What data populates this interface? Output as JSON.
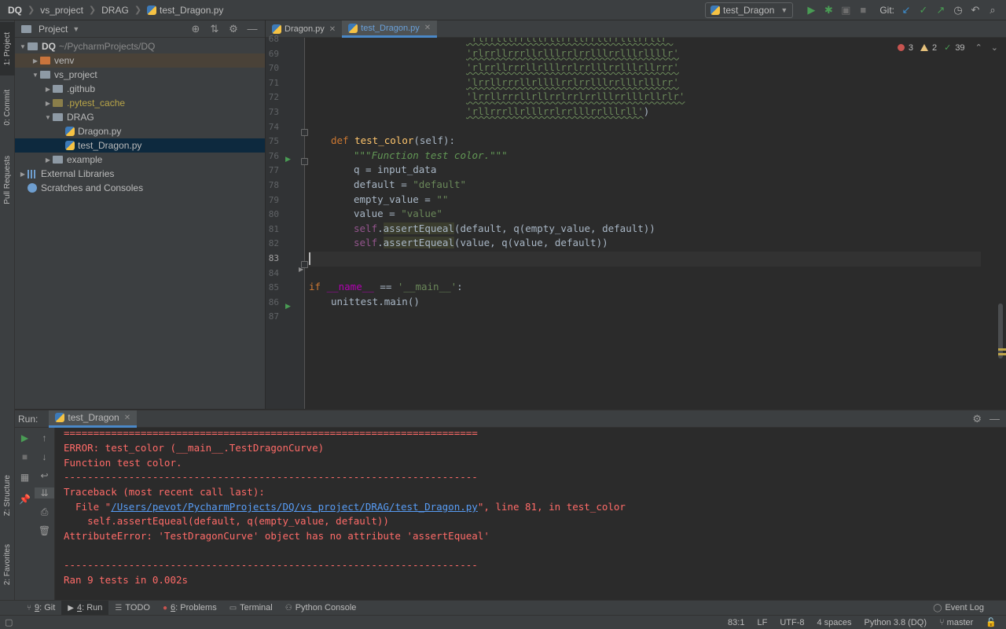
{
  "breadcrumbs": [
    "DQ",
    "vs_project",
    "DRAG",
    "test_Dragon.py"
  ],
  "toolbar": {
    "run_config": "test_Dragon",
    "git_label": "Git:"
  },
  "left_stripe": {
    "project": "1: Project",
    "commit": "0: Commit",
    "pull_requests": "Pull Requests",
    "structure": "Z: Structure",
    "favorites": "2: Favorites"
  },
  "project_panel": {
    "title": "Project",
    "tree": [
      {
        "label": "DQ",
        "hint": "~/PycharmProjects/DQ",
        "indent": 0,
        "expanded": true,
        "kind": "root"
      },
      {
        "label": "venv",
        "indent": 1,
        "expanded": false,
        "kind": "folder-orange"
      },
      {
        "label": "vs_project",
        "indent": 1,
        "expanded": true,
        "kind": "folder"
      },
      {
        "label": ".github",
        "indent": 2,
        "expanded": false,
        "kind": "folder"
      },
      {
        "label": ".pytest_cache",
        "indent": 2,
        "expanded": false,
        "kind": "folder-yellow"
      },
      {
        "label": "DRAG",
        "indent": 2,
        "expanded": true,
        "kind": "folder"
      },
      {
        "label": "Dragon.py",
        "indent": 3,
        "kind": "python"
      },
      {
        "label": "test_Dragon.py",
        "indent": 3,
        "kind": "python",
        "selected": true
      },
      {
        "label": "example",
        "indent": 2,
        "expanded": false,
        "kind": "folder"
      },
      {
        "label": "External Libraries",
        "indent": 0,
        "expanded": false,
        "kind": "library"
      },
      {
        "label": "Scratches and Consoles",
        "indent": 0,
        "kind": "scratch"
      }
    ]
  },
  "editor": {
    "tabs": [
      {
        "label": "Dragon.py",
        "active": false
      },
      {
        "label": "test_Dragon.py",
        "active": true
      }
    ],
    "inspections": {
      "errors": "3",
      "warnings": "2",
      "ok": "39"
    },
    "line_numbers": [
      "68",
      "69",
      "70",
      "71",
      "72",
      "73",
      "74",
      "75",
      "76",
      "77",
      "78",
      "79",
      "80",
      "81",
      "82",
      "83",
      "84",
      "85",
      "86",
      "87"
    ],
    "code": {
      "l68": "'rlrrlllrrlllrllrrllrrllrrlllrrllr'",
      "l69": "'rlrrllrrrllrlllrrlrrlllrrlllrllllr'",
      "l70": "'rlrrllrrrllrlllrrlrrlllrrlllrllrrr'",
      "l71": "'lrrllrrrllrllllrrlrrlllrrlllrlllrr'",
      "l72": "'lrrllrrrllrllrrlrrlrrlllrrlllrllrlr'",
      "l73": "'rllrrrllrlllrrlrrlllrrlllrll'",
      "l73_close": ")",
      "l75_def": "def",
      "l75_name": "test_color",
      "l75_params": "(self):",
      "l76": "\"\"\"Function test color.\"\"\"",
      "l77": "q = input_data",
      "l78_a": "default = ",
      "l78_b": "\"default\"",
      "l79_a": "empty_value = ",
      "l79_b": "\"\"",
      "l80_a": "value = ",
      "l80_b": "\"value\"",
      "l81_self": "self",
      "l81_dot": ".",
      "l81_method": "assertEqueal",
      "l81_rest": "(default, q(empty_value, default))",
      "l82_self": "self",
      "l82_dot": ".",
      "l82_method": "assertEqueal",
      "l82_rest": "(value, q(value, default))",
      "l85_if": "if ",
      "l85_name": "__name__",
      "l85_eq": " == ",
      "l85_main": "'__main__'",
      "l85_colon": ":",
      "l86": "unittest.main()"
    }
  },
  "run_panel": {
    "label": "Run:",
    "tab": "test_Dragon",
    "output": {
      "o1": "======================================================================",
      "o2": "ERROR: test_color (__main__.TestDragonCurve)",
      "o3": "Function test color.",
      "o4": "----------------------------------------------------------------------",
      "o5": "Traceback (most recent call last):",
      "o6_a": "  File \"",
      "o6_link": "/Users/pevot/PycharmProjects/DQ/vs_project/DRAG/test_Dragon.py",
      "o6_b": "\", line 81, in test_color",
      "o7": "    self.assertEqueal(default, q(empty_value, default))",
      "o8": "AttributeError: 'TestDragonCurve' object has no attribute 'assertEqueal'",
      "o9": "----------------------------------------------------------------------",
      "o10": "Ran 9 tests in 0.002s"
    }
  },
  "bottom_tools": {
    "git_num": "9",
    "git": ": Git",
    "run_num": "4",
    "run": ": Run",
    "todo": "TODO",
    "problems_num": "6",
    "problems": ": Problems",
    "terminal": "Terminal",
    "python_console": "Python Console",
    "event_log": "Event Log"
  },
  "status_bar": {
    "position": "83:1",
    "line_sep": "LF",
    "encoding": "UTF-8",
    "indent": "4 spaces",
    "interpreter": "Python 3.8 (DQ)",
    "branch": "master"
  },
  "colors": {
    "accent": "#4a88c7",
    "error": "#ff6b68",
    "run_green": "#499c54"
  }
}
